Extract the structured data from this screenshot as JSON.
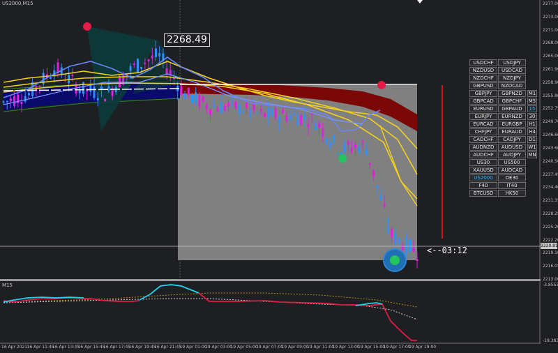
{
  "window": {
    "symbol_title": "US2000,M15",
    "sub_window_title": "M15",
    "price_tag": "2268.49",
    "countdown": "<--03:12",
    "current_price": "2220.81"
  },
  "price_axis": [
    "2277.00",
    "2274.00",
    "2271.00",
    "2268.00",
    "2265.00",
    "2261.90",
    "2258.90",
    "2255.80",
    "2252.75",
    "2249.70",
    "2246.60",
    "2243.60",
    "2240.50",
    "2237.45",
    "2234.40",
    "2231.35",
    "2228.25",
    "2225.20",
    "2222.20",
    "2219.10",
    "2216.05",
    "2213.00"
  ],
  "indicator_axis": [
    "-3.8553",
    "-19.3833"
  ],
  "time_axis": [
    "16 Apr 2021",
    "16 Apr 11:45",
    "16 Apr 13:45",
    "16 Apr 15:45",
    "16 Apr 17:45",
    "16 Apr 19:45",
    "16 Apr 21:45",
    "19 Apr 01:00",
    "19 Apr 03:00",
    "19 Apr 05:00",
    "19 Apr 07:00",
    "19 Apr 09:00",
    "19 Apr 11:00",
    "19 Apr 13:00",
    "19 Apr 15:00",
    "19 Apr 17:00",
    "19 Apr 19:00"
  ],
  "symbol_panel": {
    "rows": [
      [
        "USDCHF",
        "USDJPY"
      ],
      [
        "NZDUSD",
        "USDCAD"
      ],
      [
        "NZDCHF",
        "NZDJPY"
      ],
      [
        "GBPUSD",
        "NZDCAD"
      ],
      [
        "GBPJPY",
        "GBPNZD"
      ],
      [
        "GBPCAD",
        "GBPCHF"
      ],
      [
        "EURUSD",
        "GBPAUD"
      ],
      [
        "EURJPY",
        "EURNZD"
      ],
      [
        "EURCAD",
        "EURGBP"
      ],
      [
        "CHFJPY",
        "EURAUD"
      ],
      [
        "CADCHF",
        "CADJPY"
      ],
      [
        "AUDNZD",
        "AUDUSD"
      ],
      [
        "AUDCHF",
        "AUDJPY"
      ],
      [
        "US30",
        "US500"
      ],
      [
        "XAUUSD",
        "AUDCAD"
      ],
      [
        "US2000",
        "DE30"
      ],
      [
        "F40",
        "IT40"
      ],
      [
        "BTCUSD",
        "HK50"
      ]
    ],
    "active_symbol": "US2000",
    "timeframes": [
      "M1",
      "M5",
      "15",
      "30",
      "H1",
      "H4",
      "D1",
      "W1",
      "MN"
    ],
    "active_timeframe": "15"
  },
  "colors": {
    "background": "#1e1f22",
    "bull_candle": "#2f8fff",
    "bear_candle": "#e020e0",
    "ma_yellow": "#f2d01e",
    "band_fill": "#0a0a6a",
    "red_band": "#7a0000",
    "box_fill": "#808080",
    "osc_up": "#22d3ee",
    "osc_down": "#e11d48",
    "signal_red": "#e11d48",
    "signal_green": "#22c55e"
  },
  "chart_data": {
    "type": "line",
    "title": "US2000,M15",
    "ylim": [
      2213.0,
      2277.0
    ],
    "x": [
      "16 Apr 2021",
      "16 Apr 11:45",
      "16 Apr 13:45",
      "16 Apr 15:45",
      "16 Apr 17:45",
      "16 Apr 19:45",
      "16 Apr 21:45",
      "19 Apr 01:00",
      "19 Apr 03:00",
      "19 Apr 05:00",
      "19 Apr 07:00",
      "19 Apr 09:00",
      "19 Apr 11:00",
      "19 Apr 13:00",
      "19 Apr 15:00",
      "19 Apr 17:00",
      "19 Apr 19:00"
    ],
    "series": [
      {
        "values": [
          2254,
          2256,
          2262,
          2257,
          2256,
          2262,
          2265,
          2256,
          2253,
          2253,
          2251,
          2251,
          2250,
          2243,
          2244,
          2223,
          2219
        ]
      }
    ],
    "markers": [
      {
        "label": "2268.49",
        "value": 2268.49
      },
      {
        "label": "2220.81",
        "value": 2220.81
      }
    ],
    "indicator": {
      "values": [
        -9.0,
        -7.5,
        -9.0,
        -10.0,
        -9.5,
        -8.0,
        -3.0,
        -6.0,
        -11.0,
        -11.0,
        -12.0,
        -12.0,
        -13.5,
        -13.5,
        -11.0,
        -18.0,
        -19.3
      ],
      "ylim": [
        -19.38,
        -3.86
      ]
    }
  }
}
